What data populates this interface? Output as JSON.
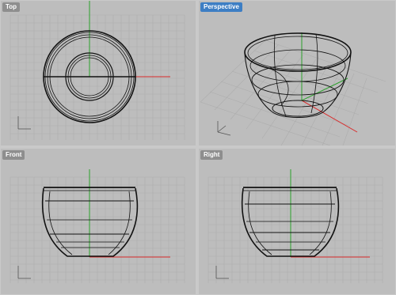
{
  "viewports": {
    "top": {
      "label": "Top"
    },
    "perspective": {
      "label": "Perspective",
      "active": true
    },
    "front": {
      "label": "Front"
    },
    "right": {
      "label": "Right"
    }
  },
  "colors": {
    "background": "#bdbdbd",
    "grid_minor": "#acacac",
    "grid_major": "#9c9c9c",
    "x_axis": "#d92a2a",
    "y_axis": "#2ca12c",
    "model": "#111111",
    "active_label": "#3d7ec4"
  }
}
